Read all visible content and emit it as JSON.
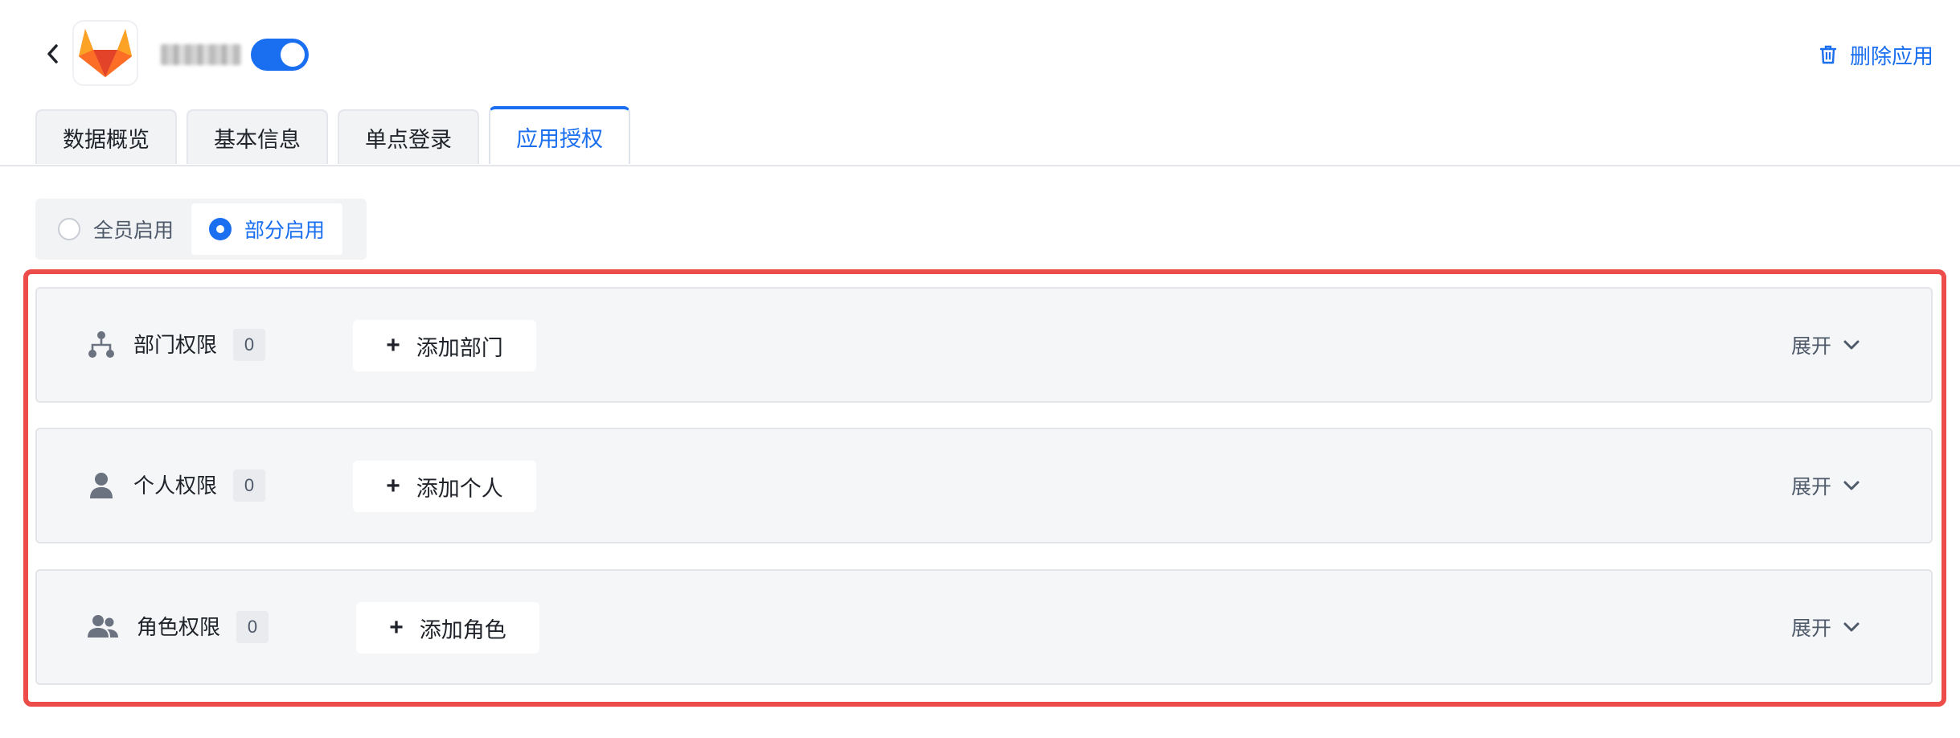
{
  "header": {
    "back_icon": "chevron-left-icon",
    "app_logo": "gitlab-logo",
    "app_enabled": true,
    "delete_label": "删除应用",
    "delete_icon": "trash-icon"
  },
  "tabs": [
    {
      "label": "数据概览",
      "active": false
    },
    {
      "label": "基本信息",
      "active": false
    },
    {
      "label": "单点登录",
      "active": false
    },
    {
      "label": "应用授权",
      "active": true
    }
  ],
  "scope": {
    "options": [
      {
        "label": "全员启用",
        "selected": false
      },
      {
        "label": "部分启用",
        "selected": true
      }
    ]
  },
  "permissions": [
    {
      "title": "部门权限",
      "count": "0",
      "add_label": "添加部门",
      "expand_label": "展开",
      "icon": "org-tree-icon"
    },
    {
      "title": "个人权限",
      "count": "0",
      "add_label": "添加个人",
      "expand_label": "展开",
      "icon": "user-icon"
    },
    {
      "title": "角色权限",
      "count": "0",
      "add_label": "添加角色",
      "expand_label": "展开",
      "icon": "users-icon"
    }
  ],
  "colors": {
    "accent": "#1a6ef0",
    "highlight": "#ec4d4a",
    "card_bg": "#f5f6f8"
  }
}
